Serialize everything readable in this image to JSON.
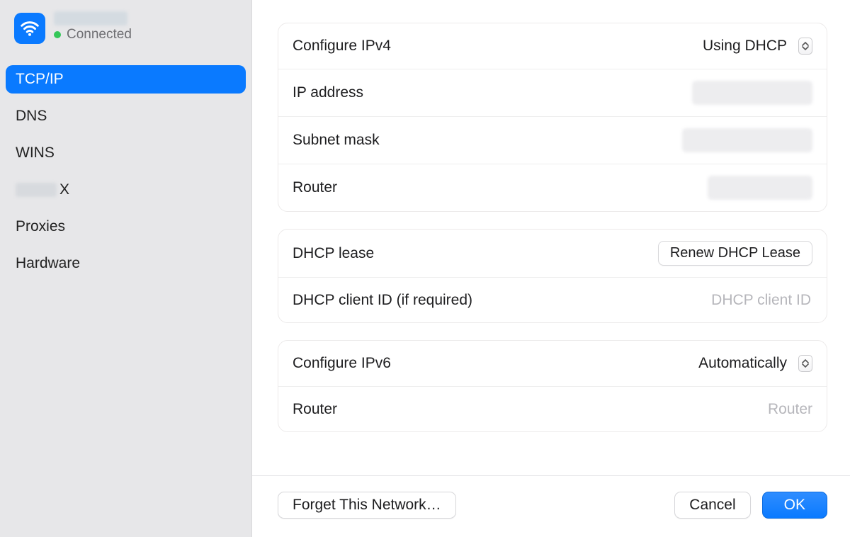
{
  "sidebar": {
    "network_name": "",
    "status_text": "Connected",
    "tabs": [
      {
        "label": "TCP/IP",
        "selected": true
      },
      {
        "label": "DNS",
        "selected": false
      },
      {
        "label": "WINS",
        "selected": false
      },
      {
        "label": "X",
        "selected": false,
        "has_redacted_prefix": true
      },
      {
        "label": "Proxies",
        "selected": false
      },
      {
        "label": "Hardware",
        "selected": false
      }
    ]
  },
  "ipv4": {
    "configure_label": "Configure IPv4",
    "configure_value": "Using DHCP",
    "ip_label": "IP address",
    "ip_value": "",
    "subnet_label": "Subnet mask",
    "subnet_value": "",
    "router_label": "Router",
    "router_value": ""
  },
  "dhcp": {
    "lease_label": "DHCP lease",
    "renew_button": "Renew DHCP Lease",
    "client_id_label": "DHCP client ID (if required)",
    "client_id_placeholder": "DHCP client ID",
    "client_id_value": ""
  },
  "ipv6": {
    "configure_label": "Configure IPv6",
    "configure_value": "Automatically",
    "router_label": "Router",
    "router_placeholder": "Router",
    "router_value": ""
  },
  "footer": {
    "forget": "Forget This Network…",
    "cancel": "Cancel",
    "ok": "OK"
  }
}
